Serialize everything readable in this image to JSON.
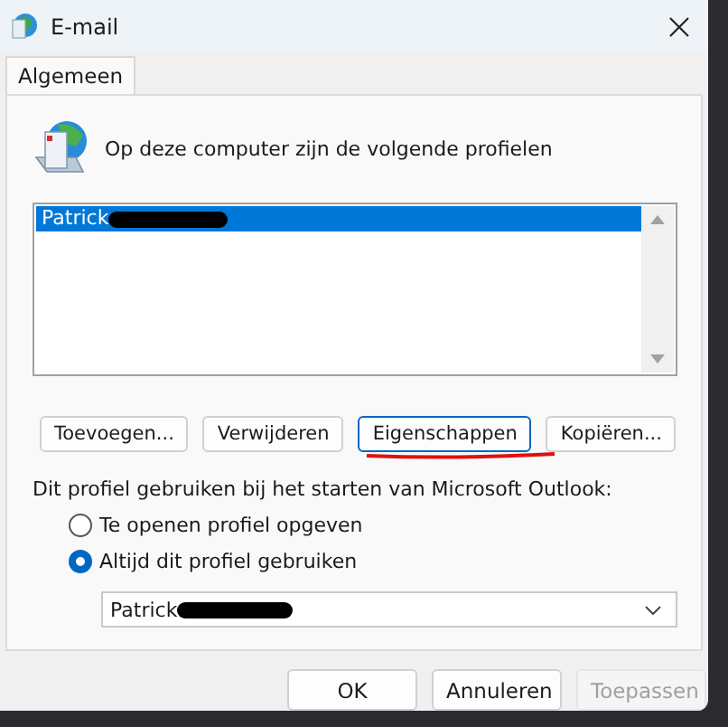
{
  "window": {
    "title": "E-mail"
  },
  "tabs": [
    {
      "label": "Algemeen",
      "selected": true
    }
  ],
  "intro": "Op deze computer zijn de volgende profielen",
  "profiles": [
    {
      "name": "Patrick",
      "selected": true,
      "redacted": true
    }
  ],
  "profile_buttons": [
    {
      "label": "Toevoegen...",
      "focused": false,
      "underlined": false
    },
    {
      "label": "Verwijderen",
      "focused": false,
      "underlined": false
    },
    {
      "label": "Eigenschappen",
      "focused": true,
      "underlined": true
    },
    {
      "label": "Kopiëren...",
      "focused": false,
      "underlined": false
    }
  ],
  "startup_label": "Dit profiel gebruiken bij het starten van Microsoft Outlook:",
  "startup_options": [
    {
      "label": "Te openen profiel opgeven",
      "selected": false
    },
    {
      "label": "Altijd dit profiel gebruiken",
      "selected": true
    }
  ],
  "profile_select": {
    "value": "Patrick",
    "redacted": true
  },
  "dialog_buttons": [
    {
      "label": "OK",
      "disabled": false
    },
    {
      "label": "Annuleren",
      "disabled": false
    },
    {
      "label": "Toepassen",
      "disabled": true
    }
  ]
}
